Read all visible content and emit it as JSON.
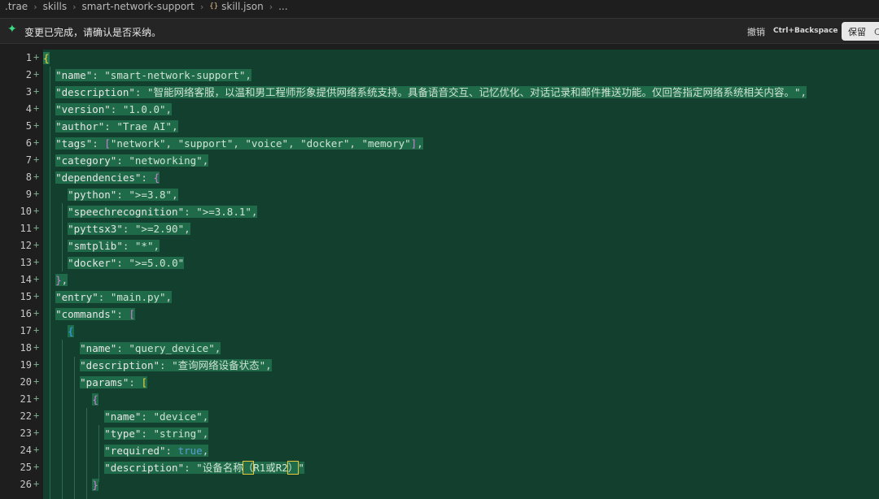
{
  "breadcrumb": {
    "items": [
      ".trae",
      "skills",
      "smart-network-support",
      "skill.json",
      "..."
    ],
    "json_icon": "{}"
  },
  "changebar": {
    "icon": "sparkle-icon",
    "accent": "#3ddc84",
    "notice": "变更已完成，请确认是否采纳。",
    "undo_label": "撤销",
    "undo_shortcut": "Ctrl+Backspace",
    "keep_label": "保留",
    "keep_extra": "C"
  },
  "editor": {
    "added_bg": "#123f2e",
    "marker": "+",
    "lines": [
      {
        "n": "1",
        "text": "{"
      },
      {
        "n": "2",
        "text": "  \"name\": \"smart-network-support\","
      },
      {
        "n": "3",
        "text": "  \"description\": \"智能网络客服，以温和男工程师形象提供网络系统支持。具备语音交互、记忆优化、对话记录和邮件推送功能。仅回答指定网络系统相关内容。\","
      },
      {
        "n": "4",
        "text": "  \"version\": \"1.0.0\","
      },
      {
        "n": "5",
        "text": "  \"author\": \"Trae AI\","
      },
      {
        "n": "6",
        "text": "  \"tags\": [\"network\", \"support\", \"voice\", \"docker\", \"memory\"],"
      },
      {
        "n": "7",
        "text": "  \"category\": \"networking\","
      },
      {
        "n": "8",
        "text": "  \"dependencies\": {"
      },
      {
        "n": "9",
        "text": "    \"python\": \">=3.8\","
      },
      {
        "n": "10",
        "text": "    \"speechrecognition\": \">=3.8.1\","
      },
      {
        "n": "11",
        "text": "    \"pyttsx3\": \">=2.90\","
      },
      {
        "n": "12",
        "text": "    \"smtplib\": \"*\","
      },
      {
        "n": "13",
        "text": "    \"docker\": \">=5.0.0\""
      },
      {
        "n": "14",
        "text": "  },"
      },
      {
        "n": "15",
        "text": "  \"entry\": \"main.py\","
      },
      {
        "n": "16",
        "text": "  \"commands\": ["
      },
      {
        "n": "17",
        "text": "    {"
      },
      {
        "n": "18",
        "text": "      \"name\": \"query_device\","
      },
      {
        "n": "19",
        "text": "      \"description\": \"查询网络设备状态\","
      },
      {
        "n": "20",
        "text": "      \"params\": ["
      },
      {
        "n": "21",
        "text": "        {"
      },
      {
        "n": "22",
        "text": "          \"name\": \"device\","
      },
      {
        "n": "23",
        "text": "          \"type\": \"string\","
      },
      {
        "n": "24",
        "text": "          \"required\": true,"
      },
      {
        "n": "25",
        "text": "          \"description\": \"设备名称（R1或R2）\""
      },
      {
        "n": "26",
        "text": "        }"
      }
    ]
  }
}
